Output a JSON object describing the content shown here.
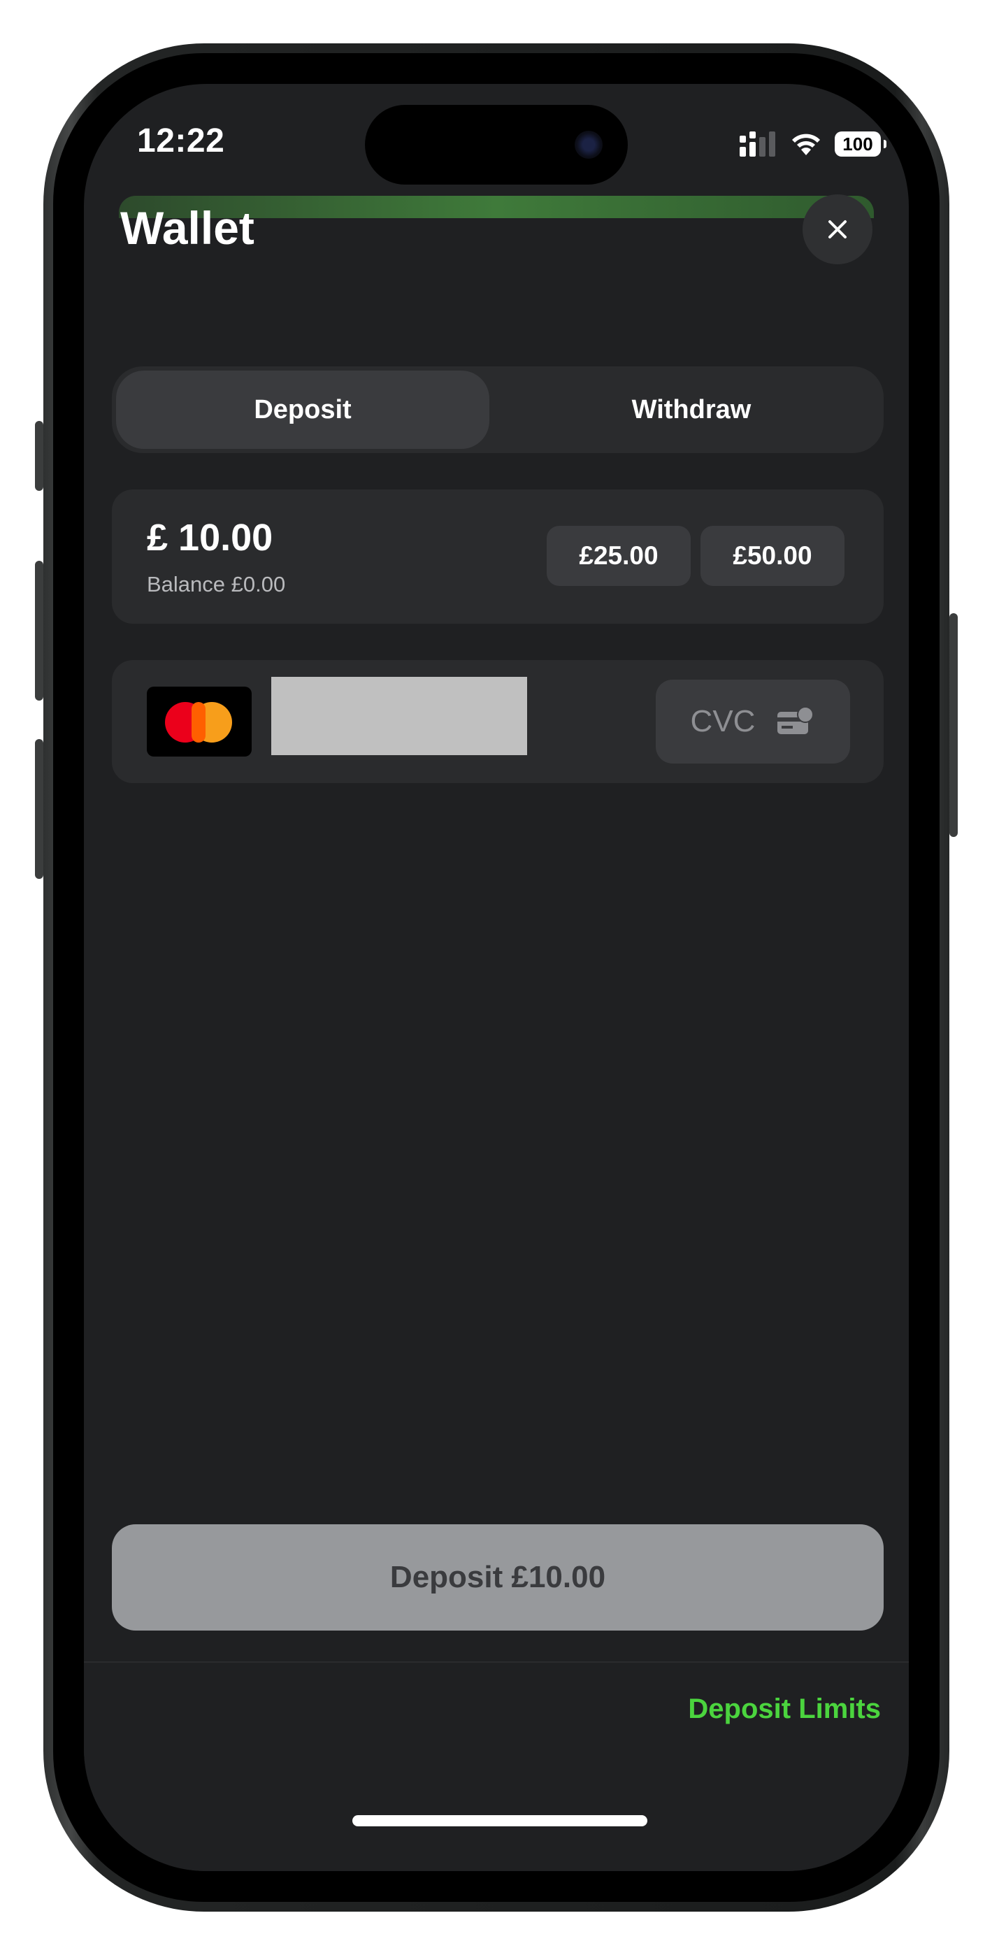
{
  "status_bar": {
    "time": "12:22",
    "battery": "100"
  },
  "header": {
    "title": "Wallet"
  },
  "tabs": [
    {
      "label": "Deposit",
      "active": true
    },
    {
      "label": "Withdraw",
      "active": false
    }
  ],
  "amount": {
    "value": "£ 10.00",
    "balance": "Balance £0.00",
    "presets": [
      "£25.00",
      "£50.00"
    ]
  },
  "card": {
    "brand_icon": "mastercard-icon",
    "cvc_placeholder": "CVC"
  },
  "action": {
    "deposit_label": "Deposit £10.00"
  },
  "footer": {
    "limits_label": "Deposit Limits"
  },
  "colors": {
    "accent": "#4bd43e",
    "background": "#1f2022",
    "card": "#2a2b2d"
  }
}
